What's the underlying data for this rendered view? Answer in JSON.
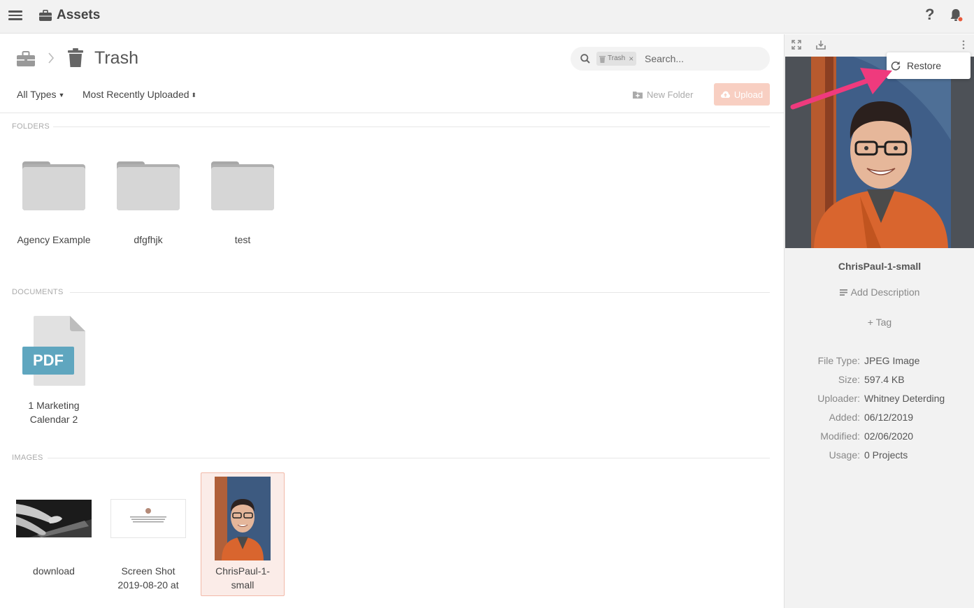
{
  "app": {
    "title": "Assets"
  },
  "header": {
    "help_label": "?"
  },
  "breadcrumb": {
    "current": "Trash"
  },
  "search": {
    "chip_label": "Trash",
    "placeholder": "Search..."
  },
  "toolbar": {
    "type_filter": "All Types",
    "sort_filter": "Most Recently Uploaded",
    "new_folder_label": "New Folder",
    "upload_label": "Upload"
  },
  "sections": {
    "folders": {
      "label": "FOLDERS",
      "items": [
        {
          "label": "Agency Example"
        },
        {
          "label": "dfgfhjk"
        },
        {
          "label": "test"
        }
      ]
    },
    "documents": {
      "label": "DOCUMENTS",
      "items": [
        {
          "label_line1": "1 Marketing",
          "label_line2": "Calendar 2",
          "badge": "PDF"
        }
      ]
    },
    "images": {
      "label": "IMAGES",
      "items": [
        {
          "label_line1": "download",
          "label_line2": ""
        },
        {
          "label_line1": "Screen Shot",
          "label_line2": "2019-08-20 at"
        },
        {
          "label_line1": "ChrisPaul-1-",
          "label_line2": "small",
          "selected": true
        }
      ]
    }
  },
  "panel": {
    "menu": {
      "restore_label": "Restore"
    },
    "file_name": "ChrisPaul-1-small",
    "add_description_label": "Add Description",
    "add_tag_label": "+ Tag",
    "metadata": [
      {
        "key": "File Type:",
        "value": "JPEG Image"
      },
      {
        "key": "Size:",
        "value": "597.4 KB"
      },
      {
        "key": "Uploader:",
        "value": "Whitney Deterding"
      },
      {
        "key": "Added:",
        "value": "06/12/2019"
      },
      {
        "key": "Modified:",
        "value": "02/06/2020"
      },
      {
        "key": "Usage:",
        "value": "0 Projects"
      }
    ]
  },
  "colors": {
    "accent": "#f8cfc2",
    "selection_bg": "#fbece8",
    "selection_border": "#f2b9a8",
    "annotation_arrow": "#ef3a7d",
    "pdf_badge": "#5fa6bf",
    "notification_dot": "#e85a3c"
  },
  "icons": {
    "menu": "hamburger-icon",
    "app": "briefcase-icon",
    "help": "help-icon",
    "notifications": "bell-icon",
    "trash": "trash-icon",
    "search": "search-icon",
    "new_folder": "folder-plus-icon",
    "upload": "cloud-upload-icon",
    "expand": "expand-icon",
    "download": "download-icon",
    "more": "more-vertical-icon",
    "restore": "restore-icon"
  }
}
